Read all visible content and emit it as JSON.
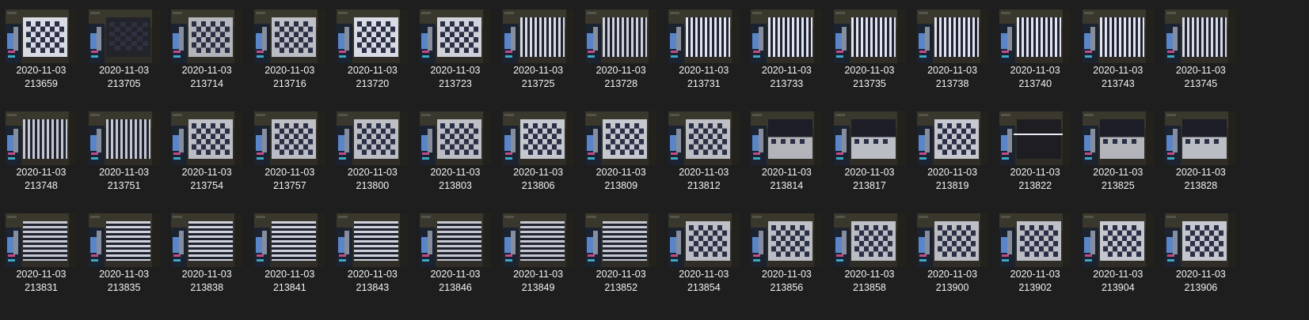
{
  "view": "folder-large-icons",
  "items": [
    {
      "date": "2020-11-03",
      "time": "213659",
      "pattern": "checker",
      "bright": 0.9
    },
    {
      "date": "2020-11-03",
      "time": "213705",
      "pattern": "dark",
      "bright": 0.15
    },
    {
      "date": "2020-11-03",
      "time": "213714",
      "pattern": "checker",
      "bright": 0.7
    },
    {
      "date": "2020-11-03",
      "time": "213716",
      "pattern": "checker",
      "bright": 0.75
    },
    {
      "date": "2020-11-03",
      "time": "213720",
      "pattern": "checker",
      "bright": 0.9
    },
    {
      "date": "2020-11-03",
      "time": "213723",
      "pattern": "checker",
      "bright": 0.85
    },
    {
      "date": "2020-11-03",
      "time": "213725",
      "pattern": "vstripes",
      "bright": 0.9
    },
    {
      "date": "2020-11-03",
      "time": "213728",
      "pattern": "vstripes",
      "bright": 0.85
    },
    {
      "date": "2020-11-03",
      "time": "213731",
      "pattern": "vstripes",
      "bright": 0.95
    },
    {
      "date": "2020-11-03",
      "time": "213733",
      "pattern": "vstripes",
      "bright": 0.95
    },
    {
      "date": "2020-11-03",
      "time": "213735",
      "pattern": "vstripes",
      "bright": 0.95
    },
    {
      "date": "2020-11-03",
      "time": "213738",
      "pattern": "vstripes",
      "bright": 0.95
    },
    {
      "date": "2020-11-03",
      "time": "213740",
      "pattern": "vstripes",
      "bright": 0.95
    },
    {
      "date": "2020-11-03",
      "time": "213743",
      "pattern": "vstripes",
      "bright": 0.95
    },
    {
      "date": "2020-11-03",
      "time": "213745",
      "pattern": "vstripes",
      "bright": 0.9
    },
    {
      "date": "2020-11-03",
      "time": "213748",
      "pattern": "vstripes",
      "bright": 0.8
    },
    {
      "date": "2020-11-03",
      "time": "213751",
      "pattern": "vstripes",
      "bright": 0.8
    },
    {
      "date": "2020-11-03",
      "time": "213754",
      "pattern": "checker",
      "bright": 0.75
    },
    {
      "date": "2020-11-03",
      "time": "213757",
      "pattern": "checker",
      "bright": 0.75
    },
    {
      "date": "2020-11-03",
      "time": "213800",
      "pattern": "checker",
      "bright": 0.75
    },
    {
      "date": "2020-11-03",
      "time": "213803",
      "pattern": "checker",
      "bright": 0.75
    },
    {
      "date": "2020-11-03",
      "time": "213806",
      "pattern": "checker",
      "bright": 0.8
    },
    {
      "date": "2020-11-03",
      "time": "213809",
      "pattern": "checker",
      "bright": 0.8
    },
    {
      "date": "2020-11-03",
      "time": "213812",
      "pattern": "checker",
      "bright": 0.75
    },
    {
      "date": "2020-11-03",
      "time": "213814",
      "pattern": "hband",
      "bright": 0.7
    },
    {
      "date": "2020-11-03",
      "time": "213817",
      "pattern": "hband",
      "bright": 0.75
    },
    {
      "date": "2020-11-03",
      "time": "213819",
      "pattern": "checker",
      "bright": 0.8
    },
    {
      "date": "2020-11-03",
      "time": "213822",
      "pattern": "darkline",
      "bright": 0.2
    },
    {
      "date": "2020-11-03",
      "time": "213825",
      "pattern": "hband",
      "bright": 0.7
    },
    {
      "date": "2020-11-03",
      "time": "213828",
      "pattern": "hband",
      "bright": 0.75
    },
    {
      "date": "2020-11-03",
      "time": "213831",
      "pattern": "hstripes",
      "bright": 0.8
    },
    {
      "date": "2020-11-03",
      "time": "213835",
      "pattern": "hstripes",
      "bright": 0.85
    },
    {
      "date": "2020-11-03",
      "time": "213838",
      "pattern": "hstripes",
      "bright": 0.85
    },
    {
      "date": "2020-11-03",
      "time": "213841",
      "pattern": "hstripes",
      "bright": 0.85
    },
    {
      "date": "2020-11-03",
      "time": "213843",
      "pattern": "hstripes",
      "bright": 0.85
    },
    {
      "date": "2020-11-03",
      "time": "213846",
      "pattern": "hstripes",
      "bright": 0.8
    },
    {
      "date": "2020-11-03",
      "time": "213849",
      "pattern": "hstripes",
      "bright": 0.8
    },
    {
      "date": "2020-11-03",
      "time": "213852",
      "pattern": "hstripes",
      "bright": 0.8
    },
    {
      "date": "2020-11-03",
      "time": "213854",
      "pattern": "checker",
      "bright": 0.75
    },
    {
      "date": "2020-11-03",
      "time": "213856",
      "pattern": "checker",
      "bright": 0.75
    },
    {
      "date": "2020-11-03",
      "time": "213858",
      "pattern": "checker",
      "bright": 0.75
    },
    {
      "date": "2020-11-03",
      "time": "213900",
      "pattern": "checker",
      "bright": 0.75
    },
    {
      "date": "2020-11-03",
      "time": "213902",
      "pattern": "checker",
      "bright": 0.75
    },
    {
      "date": "2020-11-03",
      "time": "213904",
      "pattern": "checker",
      "bright": 0.8
    },
    {
      "date": "2020-11-03",
      "time": "213906",
      "pattern": "checker",
      "bright": 0.8
    }
  ]
}
